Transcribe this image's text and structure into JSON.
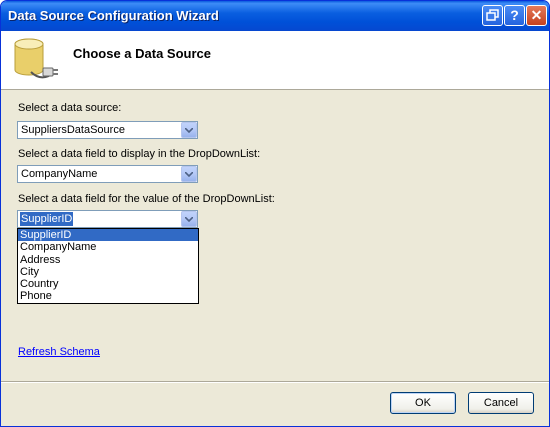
{
  "window": {
    "title": "Data Source Configuration Wizard"
  },
  "titlebar": {
    "help_glyph": "?",
    "close_glyph": "✕"
  },
  "header": {
    "title": "Choose a Data Source",
    "icon": "database-plug-icon"
  },
  "fields": {
    "data_source": {
      "label": "Select a data source:",
      "value": "SuppliersDataSource"
    },
    "display_field": {
      "label": "Select a data field to display in the DropDownList:",
      "value": "CompanyName"
    },
    "value_field": {
      "label": "Select a data field for the value of the DropDownList:",
      "value": "SupplierID"
    }
  },
  "dropdown_options": [
    "SupplierID",
    "CompanyName",
    "Address",
    "City",
    "Country",
    "Phone"
  ],
  "dropdown_selected": "SupplierID",
  "links": {
    "refresh": "Refresh Schema"
  },
  "buttons": {
    "ok": "OK",
    "cancel": "Cancel"
  },
  "colors": {
    "titlebar": "#0a5fe0",
    "selection": "#316ac5",
    "dialog_bg": "#ece9d8",
    "link": "#0000ff"
  }
}
